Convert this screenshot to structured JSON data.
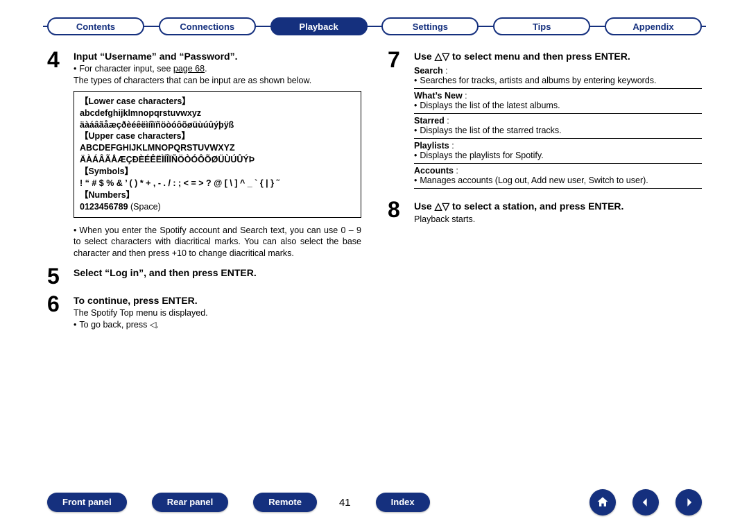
{
  "tabs": {
    "contents": "Contents",
    "connections": "Connections",
    "playback": "Playback",
    "settings": "Settings",
    "tips": "Tips",
    "appendix": "Appendix"
  },
  "left": {
    "step4": {
      "num": "4",
      "title": "Input “Username” and “Password”.",
      "note1_pre": "For character input, see ",
      "note1_link": "page 68",
      "note1_post": ".",
      "note2": "The types of characters that can be input are as shown below.",
      "box": {
        "lower_hdr": "【Lower case characters】",
        "lower1": "abcdefghijklmnopqrstuvwxyz",
        "lower2": "äàáâãåæçðèéêëìíîïñöòóôõøüùúûýþÿß",
        "upper_hdr": "【Upper case characters】",
        "upper1": "ABCDEFGHIJKLMNOPQRSTUVWXYZ",
        "upper2": "ÄÀÁÂÃÅÆÇÐÈÉÊËÌÍÎÏÑÖÒÓÔÕØÜÙÚÛÝÞ",
        "sym_hdr": "【Symbols】",
        "sym1": "! “ # $ % & ’ ( ) * + , - . / : ; < = > ? @ [ \\ ] ^ _ ` { | } ˜",
        "num_hdr": "【Numbers】",
        "num1_bold": "0123456789",
        "num1_plain": " (Space)"
      },
      "para": "When you enter the Spotify account and Search text, you can use 0 – 9 to select characters with diacritical marks. You can also select the base character and then press +10 to change diacritical marks."
    },
    "step5": {
      "num": "5",
      "title": "Select “Log in”, and then press ENTER."
    },
    "step6": {
      "num": "6",
      "title": "To continue, press ENTER.",
      "line1": "The Spotify Top menu is displayed.",
      "line2": "To go back, press ◁."
    }
  },
  "right": {
    "step7": {
      "num": "7",
      "title_pre": "Use ",
      "title_tri": "△▽",
      "title_post": " to select menu and then press ENTER.",
      "items": [
        {
          "term": "Search",
          "desc": "Searches for tracks, artists and albums by entering keywords."
        },
        {
          "term": "What’s New",
          "desc": "Displays the list of the latest albums."
        },
        {
          "term": "Starred",
          "desc": "Displays the list of the starred tracks."
        },
        {
          "term": "Playlists",
          "desc": "Displays the playlists for Spotify."
        },
        {
          "term": "Accounts",
          "desc": "Manages accounts (Log out, Add new user, Switch to user)."
        }
      ]
    },
    "step8": {
      "num": "8",
      "title_pre": "Use ",
      "title_tri": "△▽",
      "title_post": " to select a station, and press ENTER.",
      "line1": "Playback starts."
    }
  },
  "bottom": {
    "front": "Front panel",
    "rear": "Rear panel",
    "remote": "Remote",
    "page": "41",
    "index": "Index"
  }
}
